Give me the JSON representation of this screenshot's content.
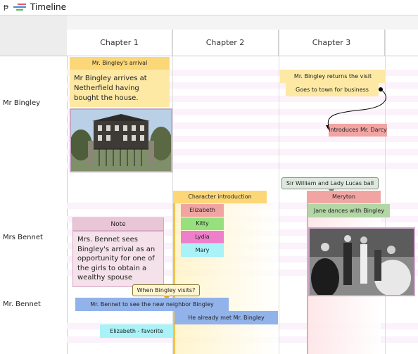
{
  "window": {
    "title": "Timeline",
    "pin_icon": "pin-icon",
    "timeline_icon": "timeline-icon"
  },
  "chapters": [
    "Chapter 1",
    "Chapter 2",
    "Chapter 3"
  ],
  "rows": [
    "Mr Bingley",
    "Mrs Bennet",
    "Mr. Bennet"
  ],
  "events": {
    "bingley_arrival_title": "Mr. Bingley's arrival",
    "bingley_arrival_text": "Mr Bingley arrives at Netherfield having bought the house.",
    "bingley_returns": "Mr. Bingley returns the visit",
    "goes_to_town": "Goes to town for business",
    "introduces_darcy": "Introduces Mr. Darcy",
    "sir_william": "Sir William and Lady Lucas ball",
    "meryton": "Meryton",
    "jane_dances": "Jane dances with Bingley",
    "character_intro": "Character introduction",
    "elizabeth": "Elizabeth",
    "kitty": "Kitty",
    "lydia": "Lydia",
    "mary": "Mary",
    "note_title": "Note",
    "note_text": "Mrs. Bennet sees Bingley's arrival as an opportunity for one of the girls to obtain a wealthy spouse",
    "when_bingley": "When Bingley visits?",
    "bennet_see": "Mr. Bennet to see the new neighbor Bingley",
    "already_met": "He already met Mr. Bingley",
    "elizabeth_fav": "Elizabeth - favorite"
  },
  "images": {
    "house": "netherfield-house-photo",
    "ball": "ball-dance-photo"
  },
  "colors": {
    "yellow": "#fde9a4",
    "red": "#f1a5a3",
    "green": "#b3d6a5",
    "blue": "#92b2ea",
    "cyan": "#a8f2f8",
    "magenta": "#ee7fca"
  }
}
